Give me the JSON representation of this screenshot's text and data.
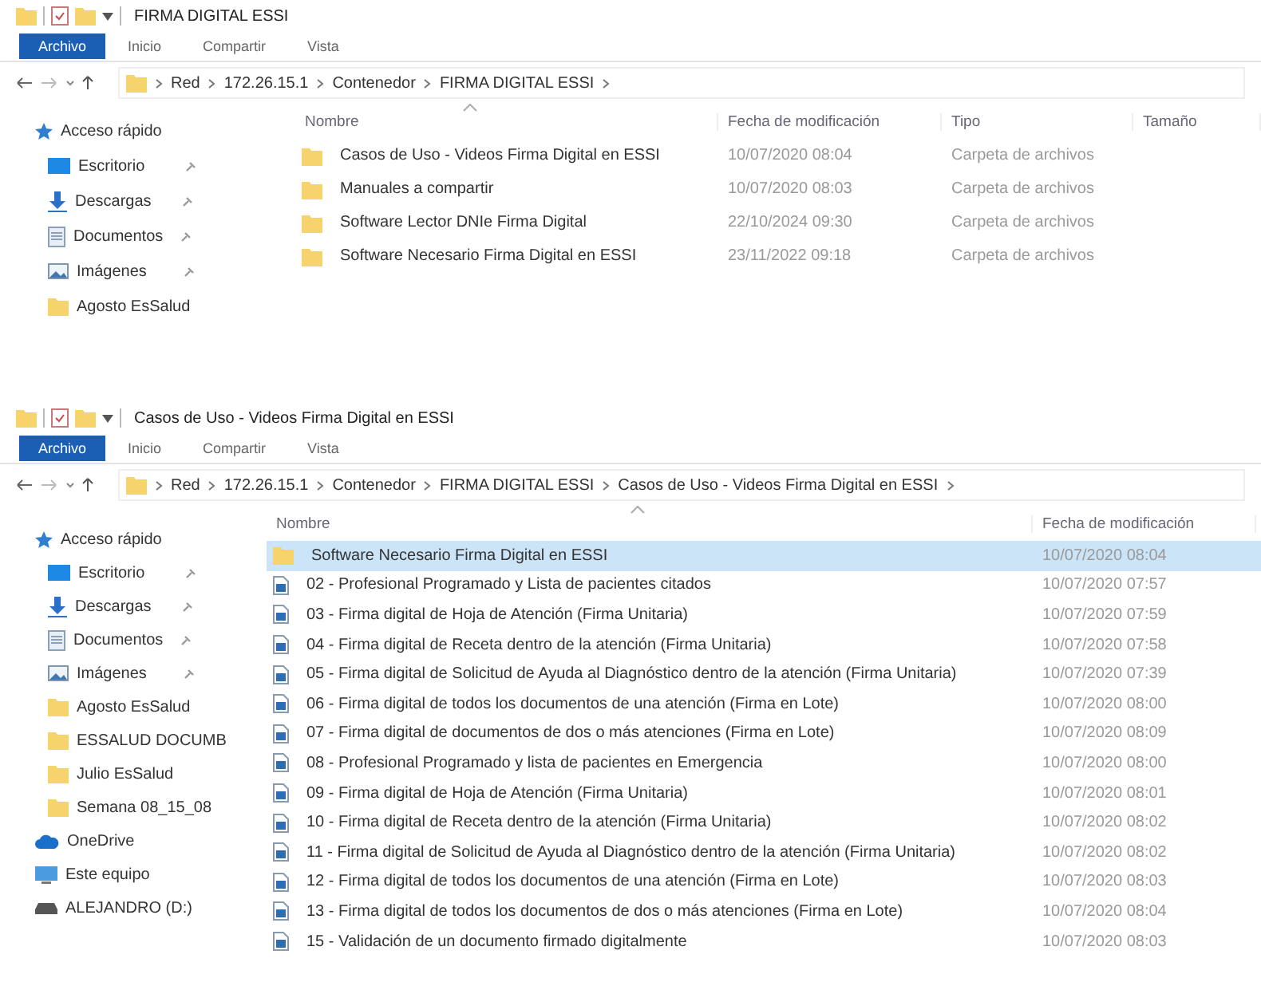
{
  "windows": [
    {
      "title": "FIRMA DIGITAL ESSI",
      "tabs": [
        {
          "label": "Archivo",
          "kind": "file-menu"
        },
        {
          "label": "Inicio",
          "kind": "tab"
        },
        {
          "label": "Compartir",
          "kind": "tab"
        },
        {
          "label": "Vista",
          "kind": "tab"
        }
      ],
      "path": [
        "Red",
        "172.26.15.1",
        "Contenedor",
        "FIRMA DIGITAL ESSI"
      ],
      "columns": [
        "Nombre",
        "Fecha de modificación",
        "Tipo",
        "Tamaño"
      ],
      "sidebar": [
        {
          "label": "Acceso rápido",
          "kind": "star",
          "pinned": false
        },
        {
          "label": "Escritorio",
          "kind": "desktop",
          "pinned": true
        },
        {
          "label": "Descargas",
          "kind": "downloads",
          "pinned": true
        },
        {
          "label": "Documentos",
          "kind": "documents",
          "pinned": true
        },
        {
          "label": "Imágenes",
          "kind": "pictures",
          "pinned": true
        },
        {
          "label": "Agosto EsSalud",
          "kind": "folder",
          "pinned": false
        }
      ],
      "rows": [
        {
          "kind": "folder",
          "selected": false,
          "cells": [
            "Casos de Uso - Videos Firma Digital en ESSI",
            "10/07/2020 08:04",
            "Carpeta de archivos"
          ]
        },
        {
          "kind": "folder",
          "selected": false,
          "cells": [
            "Manuales a compartir",
            "10/07/2020 08:03",
            "Carpeta de archivos"
          ]
        },
        {
          "kind": "folder",
          "selected": false,
          "cells": [
            "Software Lector DNIe Firma Digital",
            "22/10/2024 09:30",
            "Carpeta de archivos"
          ]
        },
        {
          "kind": "folder",
          "selected": false,
          "cells": [
            "Software Necesario Firma Digital en ESSI",
            "23/11/2022 09:18",
            "Carpeta de archivos"
          ]
        }
      ]
    },
    {
      "title": "Casos de Uso - Videos Firma Digital en ESSI",
      "tabs": [
        {
          "label": "Archivo",
          "kind": "file-menu"
        },
        {
          "label": "Inicio",
          "kind": "tab"
        },
        {
          "label": "Compartir",
          "kind": "tab"
        },
        {
          "label": "Vista",
          "kind": "tab"
        }
      ],
      "path": [
        "Red",
        "172.26.15.1",
        "Contenedor",
        "FIRMA DIGITAL ESSI",
        "Casos de Uso - Videos Firma Digital en ESSI"
      ],
      "columns": [
        "Nombre",
        "Fecha de modificación"
      ],
      "sidebar": [
        {
          "label": "Acceso rápido",
          "kind": "star",
          "pinned": false
        },
        {
          "label": "Escritorio",
          "kind": "desktop",
          "pinned": true
        },
        {
          "label": "Descargas",
          "kind": "downloads",
          "pinned": true
        },
        {
          "label": "Documentos",
          "kind": "documents",
          "pinned": true
        },
        {
          "label": "Imágenes",
          "kind": "pictures",
          "pinned": true
        },
        {
          "label": "Agosto EsSalud",
          "kind": "folder",
          "pinned": false
        },
        {
          "label": "ESSALUD DOCUMB",
          "kind": "folder",
          "pinned": false
        },
        {
          "label": "Julio EsSalud",
          "kind": "folder",
          "pinned": false
        },
        {
          "label": "Semana 08_15_08",
          "kind": "folder",
          "pinned": false
        },
        {
          "label": "OneDrive",
          "kind": "cloud",
          "pinned": false
        },
        {
          "label": "Este equipo",
          "kind": "pc",
          "pinned": false
        },
        {
          "label": "ALEJANDRO (D:)",
          "kind": "drive",
          "pinned": false
        }
      ],
      "rows": [
        {
          "kind": "folder",
          "selected": true,
          "cells": [
            "Software Necesario Firma Digital en ESSI",
            "10/07/2020 08:04"
          ]
        },
        {
          "kind": "video",
          "selected": false,
          "cells": [
            "02 - Profesional Programado y Lista de pacientes citados",
            "10/07/2020 07:57"
          ]
        },
        {
          "kind": "video",
          "selected": false,
          "cells": [
            "03 - Firma digital de Hoja de Atención (Firma Unitaria)",
            "10/07/2020 07:59"
          ]
        },
        {
          "kind": "video",
          "selected": false,
          "cells": [
            "04 - Firma digital de Receta dentro de la atención (Firma Unitaria)",
            "10/07/2020 07:58"
          ]
        },
        {
          "kind": "video",
          "selected": false,
          "cells": [
            "05 - Firma digital de Solicitud de Ayuda al Diagnóstico dentro de la atención (Firma Unitaria)",
            "10/07/2020 07:39"
          ]
        },
        {
          "kind": "video",
          "selected": false,
          "cells": [
            "06 - Firma digital de todos los documentos de una atención (Firma en Lote)",
            "10/07/2020 08:00"
          ]
        },
        {
          "kind": "video",
          "selected": false,
          "cells": [
            "07 - Firma digital de documentos de dos o más atenciones (Firma en Lote)",
            "10/07/2020 08:09"
          ]
        },
        {
          "kind": "video",
          "selected": false,
          "cells": [
            "08 - Profesional Programado y lista de pacientes en Emergencia",
            "10/07/2020 08:00"
          ]
        },
        {
          "kind": "video",
          "selected": false,
          "cells": [
            "09 - Firma digital de Hoja de Atención (Firma Unitaria)",
            "10/07/2020 08:01"
          ]
        },
        {
          "kind": "video",
          "selected": false,
          "cells": [
            "10 - Firma digital de Receta dentro de la atención (Firma Unitaria)",
            "10/07/2020 08:02"
          ]
        },
        {
          "kind": "video",
          "selected": false,
          "cells": [
            "11 - Firma digital de Solicitud de Ayuda al Diagnóstico dentro de la atención (Firma Unitaria)",
            "10/07/2020 08:02"
          ]
        },
        {
          "kind": "video",
          "selected": false,
          "cells": [
            "12 - Firma digital de todos los documentos de una atención (Firma en Lote)",
            "10/07/2020 08:03"
          ]
        },
        {
          "kind": "video",
          "selected": false,
          "cells": [
            "13 - Firma digital de todos los documentos de dos o más atenciones (Firma en Lote)",
            "10/07/2020 08:04"
          ]
        },
        {
          "kind": "video",
          "selected": false,
          "cells": [
            "15 - Validación de un documento firmado digitalmente",
            "10/07/2020 08:03"
          ]
        }
      ]
    }
  ]
}
